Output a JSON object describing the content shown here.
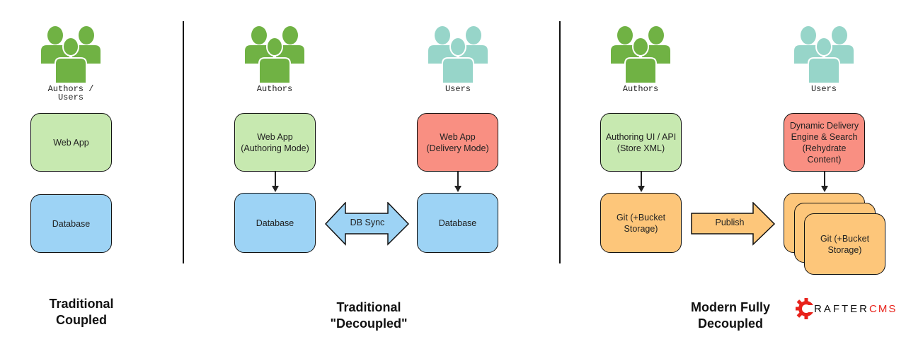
{
  "colors": {
    "authors_icon": "#70b244",
    "users_icon": "#97d5c9",
    "authoring": "#c7e9b0",
    "database": "#9dd3f5",
    "delivery": "#f98f82",
    "git": "#fdc67a",
    "logo_red": "#e8221b"
  },
  "coupled": {
    "people_label": "Authors /\nUsers",
    "web_app": "Web App",
    "database": "Database",
    "title": "Traditional\nCoupled"
  },
  "decoupled": {
    "authors_label": "Authors",
    "users_label": "Users",
    "authoring_app": "Web App\n(Authoring Mode)",
    "delivery_app": "Web App\n(Delivery Mode)",
    "database_left": "Database",
    "database_right": "Database",
    "sync_label": "DB Sync",
    "title": "Traditional\n\"Decoupled\""
  },
  "modern": {
    "authors_label": "Authors",
    "users_label": "Users",
    "authoring_ui": "Authoring UI / API\n(Store XML)",
    "delivery_engine": "Dynamic Delivery\nEngine & Search\n(Rehydrate\nContent)",
    "git_left": "Git (+Bucket\nStorage)",
    "git_right": "Git (+Bucket\nStorage)",
    "publish_label": "Publish",
    "title": "Modern Fully\nDecoupled"
  },
  "logo": {
    "text_dark": "RAFTER",
    "text_red": "CMS",
    "full": "CRAFTERCMS"
  }
}
